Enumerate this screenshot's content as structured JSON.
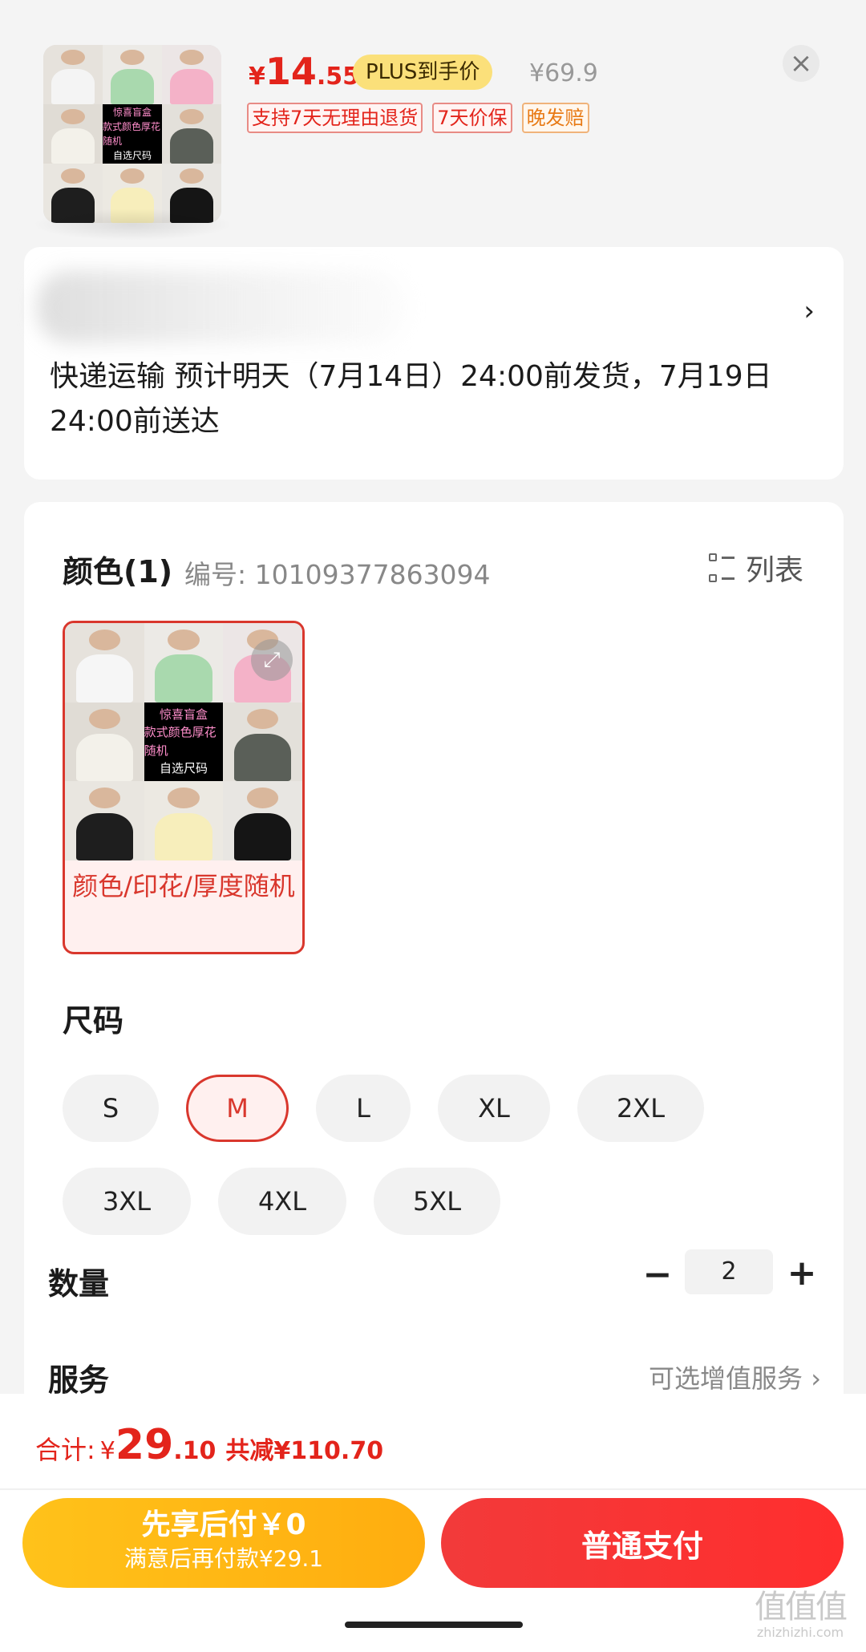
{
  "product": {
    "price_symbol": "¥",
    "price_int": "14",
    "price_dec": ".55",
    "plus_badge": "PLUS到手价",
    "original_price": "¥69.9",
    "tags": [
      "支持7天无理由退货",
      "7天价保",
      "晚发赔"
    ],
    "thumb_text": [
      "惊喜盲盒",
      "款式颜色厚花随机",
      "自选尺码"
    ]
  },
  "delivery": {
    "text": "快递运输 预计明天（7月14日）24:00前发货，7月19日24:00前送达"
  },
  "color": {
    "title": "颜色(1)",
    "sku_code": "编号: 10109377863094",
    "list_label": "列表",
    "option_label": "颜色/印花/厚度随机"
  },
  "size": {
    "title": "尺码",
    "options": [
      "S",
      "M",
      "L",
      "XL",
      "2XL",
      "3XL",
      "4XL",
      "5XL"
    ],
    "selected": "M"
  },
  "quantity": {
    "title": "数量",
    "minus": "−",
    "value": "2",
    "plus": "+"
  },
  "service": {
    "title": "服务",
    "link": "可选增值服务 ›"
  },
  "summary": {
    "label": "合计:",
    "symbol": "¥",
    "int": "29",
    "dec": ".10",
    "discount": "共减¥110.70"
  },
  "buttons": {
    "later_line1": "先享后付￥0",
    "later_line2": "满意后再付款¥29.1",
    "pay": "普通支付"
  },
  "watermark": {
    "mark": "值值值",
    "text": "zhizhizhi.com"
  },
  "colors": {
    "accent_red": "#e3241b",
    "plus_yellow": "#fbe07a",
    "later_yellow": "#ffc21a",
    "tag_orange": "#e87a15"
  }
}
